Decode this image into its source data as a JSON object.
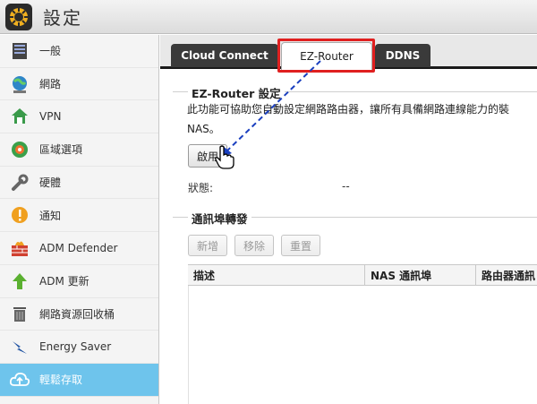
{
  "window": {
    "title": "設定"
  },
  "sidebar": {
    "items": [
      {
        "label": "一般",
        "icon": "server-icon"
      },
      {
        "label": "網路",
        "icon": "globe-icon"
      },
      {
        "label": "VPN",
        "icon": "vpn-icon"
      },
      {
        "label": "區域選項",
        "icon": "region-icon"
      },
      {
        "label": "硬體",
        "icon": "wrench-icon"
      },
      {
        "label": "通知",
        "icon": "alert-icon"
      },
      {
        "label": "ADM Defender",
        "icon": "firewall-icon"
      },
      {
        "label": "ADM 更新",
        "icon": "up-arrow-icon"
      },
      {
        "label": "網路資源回收桶",
        "icon": "trash-icon"
      },
      {
        "label": "Energy Saver",
        "icon": "lightning-icon"
      },
      {
        "label": "輕鬆存取",
        "icon": "cloud-icon",
        "active": true
      }
    ]
  },
  "tabs": [
    {
      "label": "Cloud Connect"
    },
    {
      "label": "EZ-Router",
      "active": true
    },
    {
      "label": "DDNS"
    }
  ],
  "ezrouter": {
    "section_title": "EZ-Router 設定",
    "description": "此功能可協助您自動設定網路路由器，讓所有具備網路連線能力的裝",
    "description_tail": "NAS。",
    "enable_button": "啟用",
    "status_label": "狀態:",
    "status_value": "--"
  },
  "port_forwarding": {
    "section_title": "通訊埠轉發",
    "add_button": "新增",
    "remove_button": "移除",
    "reset_button": "重置",
    "columns": [
      "描述",
      "NAS 通訊埠",
      "路由器通訊"
    ]
  },
  "colors": {
    "accent": "#6ec4ec",
    "highlight": "#e02020",
    "arrow": "#1a3fbf"
  }
}
